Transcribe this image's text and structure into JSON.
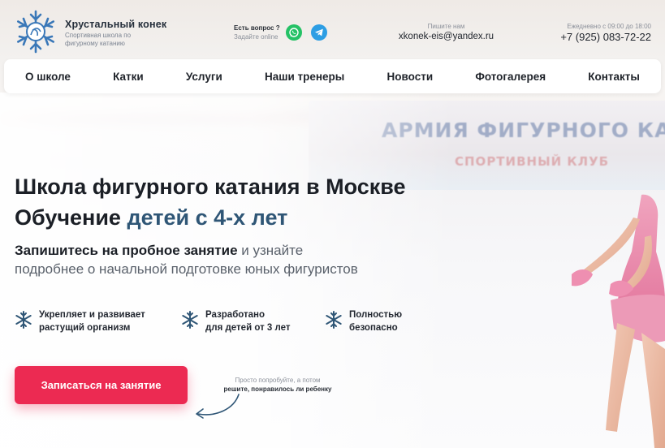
{
  "brand": {
    "title": "Хрустальный конек",
    "subtitle": "Спортивная школа по фигурному катанию"
  },
  "contacts": {
    "question": "Есть вопрос ?",
    "question_sub": "Задайте online",
    "email_label": "Пишите нам",
    "email": "xkonek-eis@yandex.ru",
    "hours": "Ежедневно с 09:00 до 18:00",
    "phone": "+7 (925) 083-72-22"
  },
  "icons": {
    "logo": "snowflake-logo-icon",
    "whatsapp": "whatsapp-icon",
    "telegram": "telegram-icon",
    "feature": "snowflake-icon"
  },
  "nav": {
    "items": [
      "О школе",
      "Катки",
      "Услуги",
      "Наши тренеры",
      "Новости",
      "Фотогалерея",
      "Контакты"
    ]
  },
  "backdrop": {
    "board_text": "АРМИЯ ФИГУРНОГО КАТАНИЯ",
    "board_sub": "СПОРТИВНЫЙ КЛУБ"
  },
  "hero": {
    "title_line1": "Школа фигурного катания в Москве",
    "title_line2_plain": "Обучение ",
    "title_line2_accent": "детей с 4-х лет",
    "sub_bold": "Запишитесь на пробное занятие",
    "sub_rest": " и узнайте подробнее о начальной подготовке юных фигуристов"
  },
  "features": [
    {
      "line1": "Укрепляет и развивает",
      "line2": "растущий организм"
    },
    {
      "line1": "Разработано",
      "line2": "для детей от 3 лет"
    },
    {
      "line1": "Полностью",
      "line2": "безопасно"
    }
  ],
  "cta": {
    "label": "Записаться на занятие",
    "hint1": "Просто попробуйте, а потом",
    "hint2": "решите, понравилось ли ребенку"
  },
  "colors": {
    "accent_red": "#ec2a52",
    "accent_blue": "#2f5676",
    "logo_blue": "#3a78b8",
    "whatsapp": "#25c266",
    "telegram": "#2d9ee4"
  }
}
